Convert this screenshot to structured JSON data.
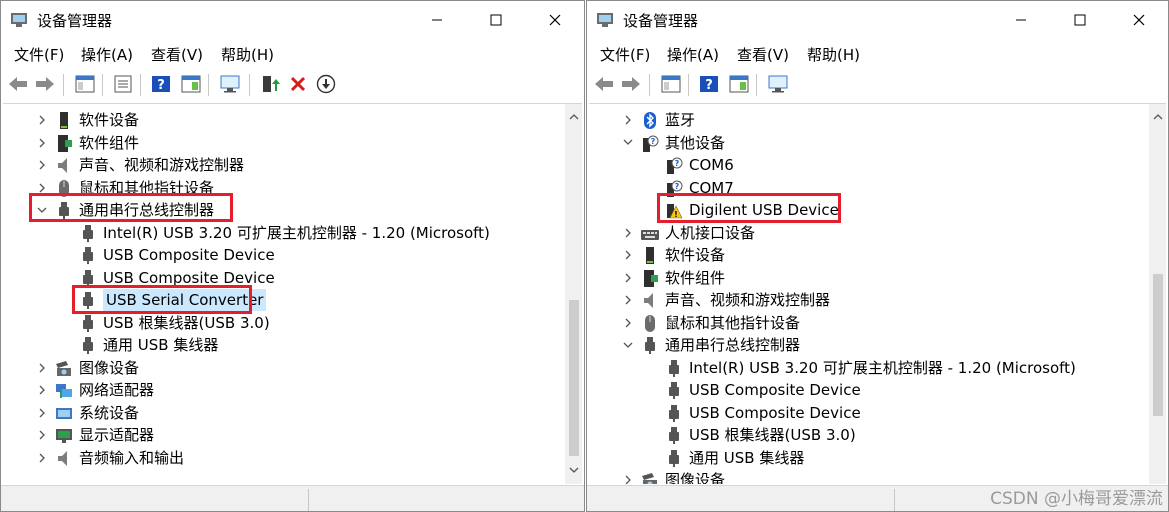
{
  "left_window": {
    "title": "设备管理器",
    "menu": [
      "文件(F)",
      "操作(A)",
      "查看(V)",
      "帮助(H)"
    ],
    "tree": [
      {
        "label": "软件设备",
        "expander": "collapsed",
        "icon": "software-device-icon"
      },
      {
        "label": "软件组件",
        "expander": "collapsed",
        "icon": "software-component-icon"
      },
      {
        "label": "声音、视频和游戏控制器",
        "expander": "collapsed",
        "icon": "speaker-icon"
      },
      {
        "label": "鼠标和其他指针设备",
        "expander": "collapsed",
        "icon": "mouse-icon"
      },
      {
        "label": "通用串行总线控制器",
        "expander": "expanded",
        "icon": "usb-plug-icon"
      },
      {
        "label": "Intel(R) USB 3.20 可扩展主机控制器 - 1.20 (Microsoft)",
        "expander": "none",
        "icon": "usb-plug-icon"
      },
      {
        "label": "USB Composite Device",
        "expander": "none",
        "icon": "usb-plug-icon"
      },
      {
        "label": "USB Composite Device",
        "expander": "none",
        "icon": "usb-plug-icon"
      },
      {
        "label": "USB Serial Converter",
        "expander": "none",
        "icon": "usb-plug-icon",
        "selected": true
      },
      {
        "label": "USB 根集线器(USB 3.0)",
        "expander": "none",
        "icon": "usb-plug-icon"
      },
      {
        "label": "通用 USB 集线器",
        "expander": "none",
        "icon": "usb-plug-icon"
      },
      {
        "label": "图像设备",
        "expander": "collapsed",
        "icon": "camera-icon"
      },
      {
        "label": "网络适配器",
        "expander": "collapsed",
        "icon": "network-adapter-icon"
      },
      {
        "label": "系统设备",
        "expander": "collapsed",
        "icon": "system-device-icon"
      },
      {
        "label": "显示适配器",
        "expander": "collapsed",
        "icon": "display-adapter-icon"
      },
      {
        "label": "音频输入和输出",
        "expander": "collapsed",
        "icon": "speaker-icon"
      }
    ]
  },
  "right_window": {
    "title": "设备管理器",
    "menu": [
      "文件(F)",
      "操作(A)",
      "查看(V)",
      "帮助(H)"
    ],
    "tree": [
      {
        "label": "蓝牙",
        "expander": "collapsed",
        "icon": "bluetooth-icon"
      },
      {
        "label": "其他设备",
        "expander": "expanded",
        "icon": "unknown-device-icon"
      },
      {
        "label": "COM6",
        "expander": "none",
        "icon": "unknown-device-icon"
      },
      {
        "label": "COM7",
        "expander": "none",
        "icon": "unknown-device-icon"
      },
      {
        "label": "Digilent USB Device",
        "expander": "none",
        "icon": "warning-device-icon"
      },
      {
        "label": "人机接口设备",
        "expander": "collapsed",
        "icon": "keyboard-icon"
      },
      {
        "label": "软件设备",
        "expander": "collapsed",
        "icon": "software-device-icon"
      },
      {
        "label": "软件组件",
        "expander": "collapsed",
        "icon": "software-component-icon"
      },
      {
        "label": "声音、视频和游戏控制器",
        "expander": "collapsed",
        "icon": "speaker-icon"
      },
      {
        "label": "鼠标和其他指针设备",
        "expander": "collapsed",
        "icon": "mouse-icon"
      },
      {
        "label": "通用串行总线控制器",
        "expander": "expanded",
        "icon": "usb-plug-icon"
      },
      {
        "label": "Intel(R) USB 3.20 可扩展主机控制器 - 1.20 (Microsoft)",
        "expander": "none",
        "icon": "usb-plug-icon"
      },
      {
        "label": "USB Composite Device",
        "expander": "none",
        "icon": "usb-plug-icon"
      },
      {
        "label": "USB Composite Device",
        "expander": "none",
        "icon": "usb-plug-icon"
      },
      {
        "label": "USB 根集线器(USB 3.0)",
        "expander": "none",
        "icon": "usb-plug-icon"
      },
      {
        "label": "通用 USB 集线器",
        "expander": "none",
        "icon": "usb-plug-icon"
      },
      {
        "label": "图像设备",
        "expander": "collapsed",
        "icon": "camera-icon"
      }
    ]
  },
  "watermark": "CSDN @小梅哥爱漂流",
  "colors": {
    "highlight_box": "#e41f2b",
    "selection": "#cce8ff",
    "usb_icon": "#555555"
  }
}
